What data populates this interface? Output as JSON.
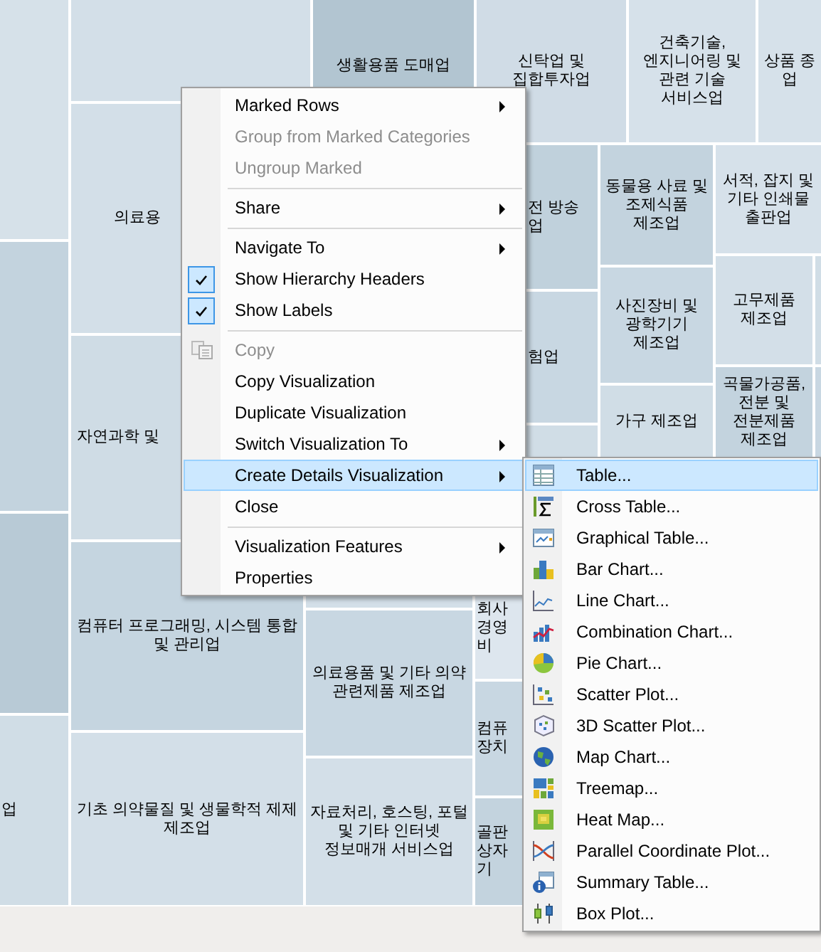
{
  "treemap": {
    "tiles": [
      {
        "color": "#d6e1e9"
      },
      {
        "color": "#c3d3de"
      },
      {
        "color": "#b8cad6"
      },
      {
        "label": "업",
        "color": "#d0dde6"
      },
      {
        "color": "#d3dfe8"
      },
      {
        "label": "의료용",
        "color": "#d3dfe8"
      },
      {
        "label": "자연과학 및",
        "color": "#cfdce5"
      },
      {
        "label": "컴퓨터 프로그래밍, 시스템 통합 및 관리업",
        "color": "#c5d5e0"
      },
      {
        "label": "기초 의약물질 및 생물학적 제제 제조업",
        "color": "#d3dfe8"
      },
      {
        "label": "생활용품 도매업",
        "color": "#b2c5d1"
      },
      {
        "label": "신탁업 및 집합투자업",
        "color": "#d0dce6"
      },
      {
        "label": "건축기술, 엔지니어링 및 관련 기술 서비스업",
        "color": "#d6e1ea"
      },
      {
        "label": "상품 종\n업",
        "color": "#d6e1ea"
      },
      {
        "label": "전 방송\n업",
        "color": "#c0d1dc"
      },
      {
        "label": "험업",
        "color": "#c8d7e2"
      },
      {
        "color": "#d0dde6"
      },
      {
        "label": "동물용 사료 및 조제식품 제조업",
        "color": "#c3d3de"
      },
      {
        "label": "사진장비 및 광학기기 제조업",
        "color": "#c8d7e2"
      },
      {
        "label": "가구 제조업",
        "color": "#d0dde6"
      },
      {
        "label": "서적, 잡지 및 기타 인쇄물 출판업",
        "color": "#d6e1ea"
      },
      {
        "label": "고무제품 제조업",
        "color": "#d3dfe8"
      },
      {
        "color": "#d0dde6"
      },
      {
        "label": "곡물가공품, 전분 및 전분제품 제조업",
        "color": "#c3d3de"
      },
      {
        "color": "#c8d7e2"
      },
      {
        "color": "#d3dfe8"
      },
      {
        "label": "의료용품 및 기타 의약 관련제품 제조업",
        "color": "#c8d7e2"
      },
      {
        "label": "자료처리, 호스팅, 포털 및 기타 인터넷 정보매개 서비스업",
        "color": "#d3dfe8"
      },
      {
        "label": "회사\n경영\n비",
        "color": "#dde6ee"
      },
      {
        "label": "컴퓨\n장치",
        "color": "#c8d7e2"
      },
      {
        "label": "골판\n상자\n기",
        "color": "#c3d3de"
      }
    ]
  },
  "context_menu": {
    "items": [
      {
        "kind": "item",
        "label": "Marked Rows",
        "disabled": false,
        "submenu": true,
        "selected": false
      },
      {
        "kind": "item",
        "label": "Group from Marked Categories",
        "disabled": true,
        "submenu": false,
        "selected": false
      },
      {
        "kind": "item",
        "label": "Ungroup Marked",
        "disabled": true,
        "submenu": false,
        "selected": false
      },
      {
        "kind": "separator"
      },
      {
        "kind": "item",
        "label": "Share",
        "disabled": false,
        "submenu": true,
        "selected": false
      },
      {
        "kind": "separator"
      },
      {
        "kind": "item",
        "label": "Navigate To",
        "disabled": false,
        "submenu": true,
        "selected": false
      },
      {
        "kind": "check",
        "label": "Show Hierarchy Headers",
        "checked": true,
        "selected": false
      },
      {
        "kind": "check",
        "label": "Show Labels",
        "checked": true,
        "selected": false
      },
      {
        "kind": "separator"
      },
      {
        "kind": "icon-item",
        "label": "Copy",
        "disabled": true,
        "submenu": false,
        "selected": false
      },
      {
        "kind": "item",
        "label": "Copy Visualization",
        "disabled": false,
        "submenu": false,
        "selected": false
      },
      {
        "kind": "item",
        "label": "Duplicate Visualization",
        "disabled": false,
        "submenu": false,
        "selected": false
      },
      {
        "kind": "item",
        "label": "Switch Visualization To",
        "disabled": false,
        "submenu": true,
        "selected": false
      },
      {
        "kind": "item",
        "label": "Create Details Visualization",
        "disabled": false,
        "submenu": true,
        "selected": true
      },
      {
        "kind": "item",
        "label": "Close",
        "disabled": false,
        "submenu": false,
        "selected": false
      },
      {
        "kind": "separator"
      },
      {
        "kind": "item",
        "label": "Visualization Features",
        "disabled": false,
        "submenu": true,
        "selected": false
      },
      {
        "kind": "item",
        "label": "Properties",
        "disabled": false,
        "submenu": false,
        "selected": false
      }
    ]
  },
  "submenu": {
    "items": [
      {
        "label": "Table...",
        "selected": true
      },
      {
        "label": "Cross Table...",
        "selected": false
      },
      {
        "label": "Graphical Table...",
        "selected": false
      },
      {
        "label": "Bar Chart...",
        "selected": false
      },
      {
        "label": "Line Chart...",
        "selected": false
      },
      {
        "label": "Combination Chart...",
        "selected": false
      },
      {
        "label": "Pie Chart...",
        "selected": false
      },
      {
        "label": "Scatter Plot...",
        "selected": false
      },
      {
        "label": "3D Scatter Plot...",
        "selected": false
      },
      {
        "label": "Map Chart...",
        "selected": false
      },
      {
        "label": "Treemap...",
        "selected": false
      },
      {
        "label": "Heat Map...",
        "selected": false
      },
      {
        "label": "Parallel Coordinate Plot...",
        "selected": false
      },
      {
        "label": "Summary Table...",
        "selected": false
      },
      {
        "label": "Box Plot...",
        "selected": false
      }
    ]
  }
}
